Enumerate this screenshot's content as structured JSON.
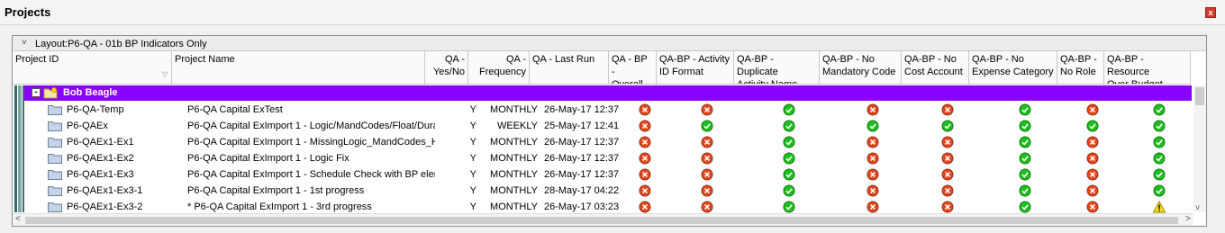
{
  "window": {
    "title": "Projects",
    "close_glyph": "x"
  },
  "layout": {
    "label": "Layout:P6-QA - 01b BP Indicators Only",
    "chevron": "˅"
  },
  "columns": [
    {
      "l1": "Project ID",
      "l2": ""
    },
    {
      "l1": "Project Name",
      "l2": ""
    },
    {
      "l1": "QA -",
      "l2": "Yes/No"
    },
    {
      "l1": "QA -",
      "l2": "Frequency"
    },
    {
      "l1": "QA - Last Run",
      "l2": ""
    },
    {
      "l1": "QA - BP -",
      "l2": "Overall"
    },
    {
      "l1": "QA-BP - Activity",
      "l2": "ID Format"
    },
    {
      "l1": "QA-BP - Duplicate",
      "l2": "Activity Name"
    },
    {
      "l1": "QA-BP - No",
      "l2": "Mandatory Code"
    },
    {
      "l1": "QA-BP - No",
      "l2": "Cost Account"
    },
    {
      "l1": "QA-BP - No",
      "l2": "Expense Category"
    },
    {
      "l1": "QA-BP -",
      "l2": "No Role"
    },
    {
      "l1": "QA-BP - Resource",
      "l2": "Over Budget"
    }
  ],
  "group": {
    "label": "Bob Beagle",
    "color": "#8a00ff"
  },
  "rows": [
    {
      "id": "P6-QA-Temp",
      "name": "P6-QA Capital ExTest",
      "yn": "Y",
      "freq": "MONTHLY",
      "last": "26-May-17 12:37",
      "status": [
        "fail",
        "fail",
        "pass",
        "fail",
        "fail",
        "pass",
        "fail",
        "pass"
      ]
    },
    {
      "id": "P6-QAEx",
      "name": "P6-QA Capital ExImport 1 - Logic/MandCodes/Float/Dural",
      "yn": "Y",
      "freq": "WEEKLY",
      "last": "25-May-17 12:41",
      "status": [
        "fail",
        "pass",
        "pass",
        "pass",
        "pass",
        "pass",
        "pass",
        "pass"
      ]
    },
    {
      "id": "P6-QAEx1-Ex1",
      "name": "P6-QA Capital ExImport 1 - MissingLogic_MandCodes_Hig",
      "yn": "Y",
      "freq": "MONTHLY",
      "last": "26-May-17 12:37",
      "status": [
        "fail",
        "fail",
        "pass",
        "fail",
        "fail",
        "pass",
        "fail",
        "pass"
      ]
    },
    {
      "id": "P6-QAEx1-Ex2",
      "name": "P6-QA Capital ExImport 1 - Logic Fix",
      "yn": "Y",
      "freq": "MONTHLY",
      "last": "26-May-17 12:37",
      "status": [
        "fail",
        "fail",
        "pass",
        "fail",
        "fail",
        "pass",
        "fail",
        "pass"
      ]
    },
    {
      "id": "P6-QAEx1-Ex3",
      "name": "P6-QA Capital ExImport 1 - Schedule Check with BP eleme",
      "yn": "Y",
      "freq": "MONTHLY",
      "last": "26-May-17 12:37",
      "status": [
        "fail",
        "fail",
        "pass",
        "fail",
        "fail",
        "pass",
        "fail",
        "pass"
      ]
    },
    {
      "id": "P6-QAEx1-Ex3-1",
      "name": "P6-QA Capital ExImport 1 - 1st progress",
      "yn": "Y",
      "freq": "MONTHLY",
      "last": "28-May-17 04:22",
      "status": [
        "fail",
        "fail",
        "pass",
        "fail",
        "fail",
        "pass",
        "fail",
        "pass"
      ]
    },
    {
      "id": "P6-QAEx1-Ex3-2",
      "name": "* P6-QA Capital ExImport 1 - 3rd progress",
      "yn": "Y",
      "freq": "MONTHLY",
      "last": "26-May-17 03:23",
      "status": [
        "fail",
        "fail",
        "pass",
        "fail",
        "fail",
        "pass",
        "fail",
        "warn"
      ]
    }
  ],
  "icons": {
    "pass": "check-circle-icon",
    "fail": "x-circle-icon",
    "warn": "warning-triangle-icon",
    "folder": "folder-icon"
  },
  "colors": {
    "pass": "#1fbf1f",
    "fail": "#e2471c",
    "warn": "#f5e21b",
    "group": "#8a00ff"
  }
}
